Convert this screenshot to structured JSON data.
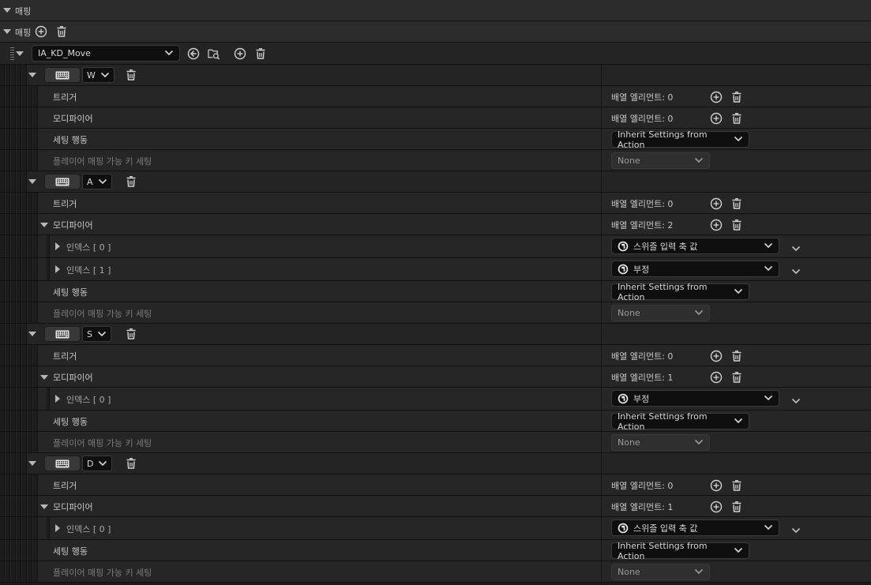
{
  "header": {
    "title": "매핑"
  },
  "mappings": {
    "label": "매핑"
  },
  "action": {
    "name": "IA_KD_Move"
  },
  "keys": [
    {
      "key": "W",
      "trigger_label": "트리거",
      "trigger_count": "배열 엘리먼트: 0",
      "modifier_label": "모디파이어",
      "modifier_count": "배열 엘리먼트: 0",
      "modifiers": [],
      "settings_label": "세팅 행동",
      "settings_value": "Inherit Settings from Action",
      "player_label": "플레이어 매핑 가능 키 세팅",
      "player_value": "None"
    },
    {
      "key": "A",
      "trigger_label": "트리거",
      "trigger_count": "배열 엘리먼트: 0",
      "modifier_label": "모디파이어",
      "modifier_count": "배열 엘리먼트: 2",
      "modifiers": [
        {
          "index": "인덱스 [ 0 ]",
          "value": "스위즐 입력 축 값"
        },
        {
          "index": "인덱스 [ 1 ]",
          "value": "부정"
        }
      ],
      "settings_label": "세팅 행동",
      "settings_value": "Inherit Settings from Action",
      "player_label": "플레이어 매핑 가능 키 세팅",
      "player_value": "None"
    },
    {
      "key": "S",
      "trigger_label": "트리거",
      "trigger_count": "배열 엘리먼트: 0",
      "modifier_label": "모디파이어",
      "modifier_count": "배열 엘리먼트: 1",
      "modifiers": [
        {
          "index": "인덱스 [ 0 ]",
          "value": "부정"
        }
      ],
      "settings_label": "세팅 행동",
      "settings_value": "Inherit Settings from Action",
      "player_label": "플레이어 매핑 가능 키 세팅",
      "player_value": "None"
    },
    {
      "key": "D",
      "trigger_label": "트리거",
      "trigger_count": "배열 엘리먼트: 0",
      "modifier_label": "모디파이어",
      "modifier_count": "배열 엘리먼트: 1",
      "modifiers": [
        {
          "index": "인덱스 [ 0 ]",
          "value": "스위즐 입력 축 값"
        }
      ],
      "settings_label": "세팅 행동",
      "settings_value": "Inherit Settings from Action",
      "player_label": "플레이어 매핑 가능 키 세팅",
      "player_value": "None"
    }
  ],
  "icons": {
    "expand": "triangle-down-icon",
    "collapsed": "triangle-right-icon",
    "add": "plus-circle-icon",
    "delete": "trash-icon",
    "keyboard": "keyboard-icon",
    "browse": "arrow-left-circle-icon",
    "find": "folder-search-icon",
    "modifier": "unreal-logo-icon",
    "dropdown": "chevron-down-icon"
  }
}
